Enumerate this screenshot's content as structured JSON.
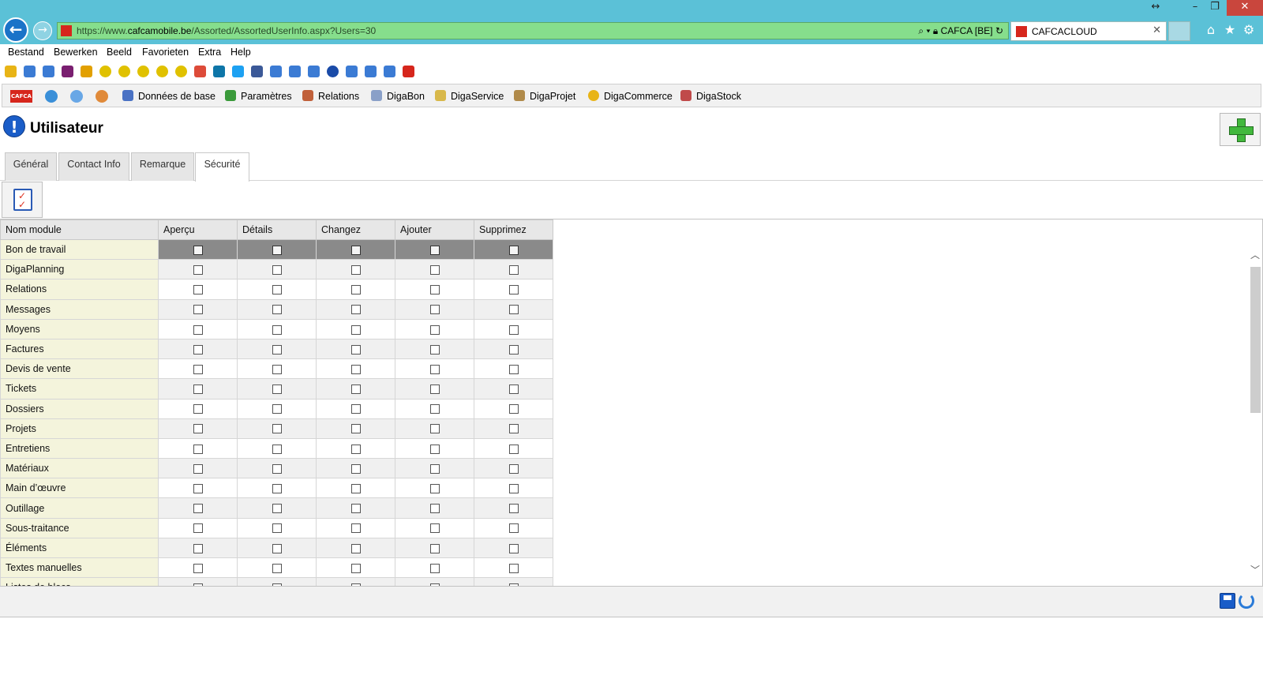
{
  "browser": {
    "url_prefix": "https://www.",
    "url_domain": "cafcamobile.be",
    "url_path": "/Assorted/AssortedUserInfo.aspx?Users=30",
    "site_badge": "CAFCA [BE]",
    "tab_title": "CAFCACLOUD",
    "window_controls": {
      "resize": "↔",
      "minimize": "–",
      "maximize": "❐",
      "close": "✕"
    }
  },
  "menu": [
    "Bestand",
    "Bewerken",
    "Beeld",
    "Favorieten",
    "Extra",
    "Help"
  ],
  "app_toolbar": {
    "logo_text": "CAFCA",
    "items": [
      "Données de base",
      "Paramètres",
      "Relations",
      "DigaBon",
      "DigaService",
      "DigaProjet",
      "DigaCommerce",
      "DigaStock"
    ]
  },
  "page": {
    "title": "Utilisateur",
    "info_glyph": "!"
  },
  "tabs": [
    "Général",
    "Contact Info",
    "Remarque",
    "Sécurité"
  ],
  "active_tab": "Sécurité",
  "grid": {
    "columns": [
      "Nom module",
      "Aperçu",
      "Détails",
      "Changez",
      "Ajouter",
      "Supprimez"
    ],
    "rows": [
      {
        "name": "Bon de travail",
        "selected": true
      },
      {
        "name": "DigaPlanning"
      },
      {
        "name": "Relations"
      },
      {
        "name": "Messages"
      },
      {
        "name": "Moyens"
      },
      {
        "name": "Factures"
      },
      {
        "name": "Devis de vente"
      },
      {
        "name": "Tickets"
      },
      {
        "name": "Dossiers"
      },
      {
        "name": "Projets"
      },
      {
        "name": "Entretiens"
      },
      {
        "name": "Matériaux"
      },
      {
        "name": "Main d’œuvre"
      },
      {
        "name": "Outillage"
      },
      {
        "name": "Sous-traitance"
      },
      {
        "name": "Éléments"
      },
      {
        "name": "Textes manuelles"
      },
      {
        "name": "Listes de blocs"
      }
    ]
  },
  "colors": {
    "chrome": "#5bc1d7",
    "address_bar": "#86de8c",
    "name_cell": "#f4f4dc",
    "selected_row": "#8a8a8a",
    "accent_blue": "#1a5dc8",
    "add_green": "#42b83d"
  }
}
